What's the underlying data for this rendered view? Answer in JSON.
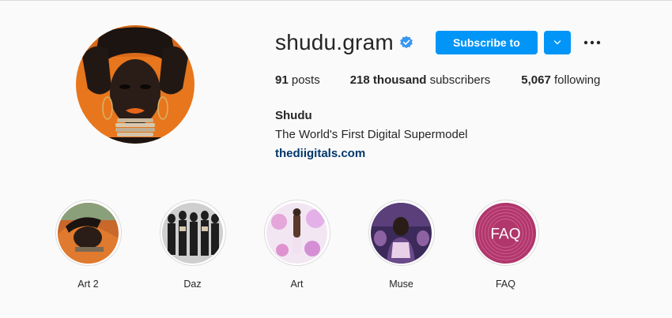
{
  "profile": {
    "username": "shudu.gram",
    "verified": true,
    "full_name": "Shudu",
    "bio": "The World's First Digital Supermodel",
    "website": "thediigitals.com",
    "avatar_icon": "profile-photo"
  },
  "actions": {
    "subscribe_label": "Subscribe to",
    "dropdown_icon": "chevron-down-icon",
    "more_icon": "more-options-icon"
  },
  "stats": {
    "posts_count": "91",
    "posts_label": " posts",
    "subscribers_count": "218 thousand",
    "subscribers_label": " subscribers",
    "following_count": "5,067",
    "following_label": " following"
  },
  "highlights": [
    {
      "label": "Art 2"
    },
    {
      "label": "Daz"
    },
    {
      "label": "Art"
    },
    {
      "label": "Muse"
    },
    {
      "label": "FAQ",
      "cover_text": "FAQ"
    }
  ],
  "colors": {
    "accent": "#0095f6",
    "link": "#00376b",
    "text": "#262626",
    "background": "#fafafa",
    "faq_cover": "#b0366b"
  }
}
